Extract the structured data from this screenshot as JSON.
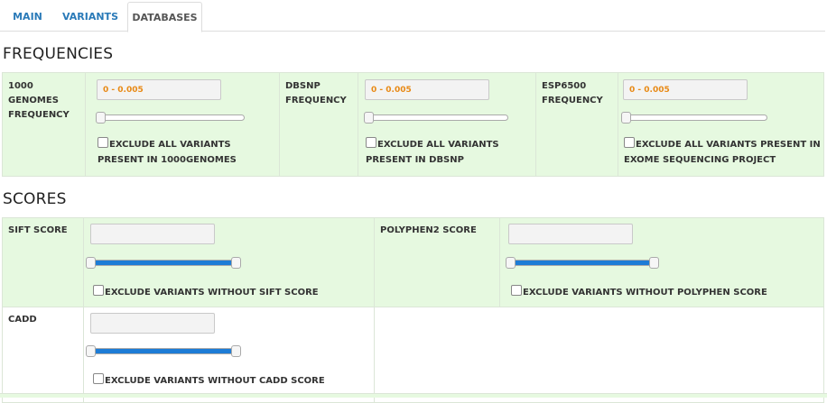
{
  "tabs": [
    {
      "label": "MAIN",
      "active": false
    },
    {
      "label": "VARIANTS",
      "active": false
    },
    {
      "label": "DATABASES",
      "active": true
    }
  ],
  "frequencies": {
    "title": "FREQUENCIES",
    "items": [
      {
        "label_line1": "1000 GENOMES",
        "label_line2": "FREQUENCY",
        "value": "0 - 0.005",
        "slider_value": 0.005,
        "checkbox_line1": "EXCLUDE ALL VARIANTS",
        "checkbox_line2": "PRESENT IN 1000GENOMES",
        "checked": false
      },
      {
        "label_line1": "DBSNP",
        "label_line2": "FREQUENCY",
        "value": "0 - 0.005",
        "slider_value": 0.005,
        "checkbox_line1": "EXCLUDE ALL VARIANTS",
        "checkbox_line2": "PRESENT IN DBSNP",
        "checked": false
      },
      {
        "label_line1": "ESP6500",
        "label_line2": "FREQUENCY",
        "value": "0 - 0.005",
        "slider_value": 0.005,
        "checkbox_line1": "EXCLUDE ALL VARIANTS PRESENT IN",
        "checkbox_line2": "EXOME SEQUENCING PROJECT",
        "checked": false
      }
    ]
  },
  "scores": {
    "title": "SCORES",
    "items": [
      {
        "label": "SIFT SCORE",
        "value": "",
        "range": [
          0,
          1
        ],
        "checkbox": "EXCLUDE VARIANTS WITHOUT SIFT SCORE",
        "checked": false
      },
      {
        "label": "POLYPHEN2 SCORE",
        "value": "",
        "range": [
          0,
          1
        ],
        "checkbox": "EXCLUDE VARIANTS WITHOUT POLYPHEN SCORE",
        "checked": false
      },
      {
        "label": "CADD",
        "value": "",
        "range": [
          0,
          1
        ],
        "checkbox": "EXCLUDE VARIANTS WITHOUT CADD SCORE",
        "checked": false
      }
    ]
  },
  "colors": {
    "accent": "#2a7ab8",
    "range_text": "#e88a16",
    "slider_fill": "#1d7cd6",
    "section_bg": "#e6f9e0"
  }
}
